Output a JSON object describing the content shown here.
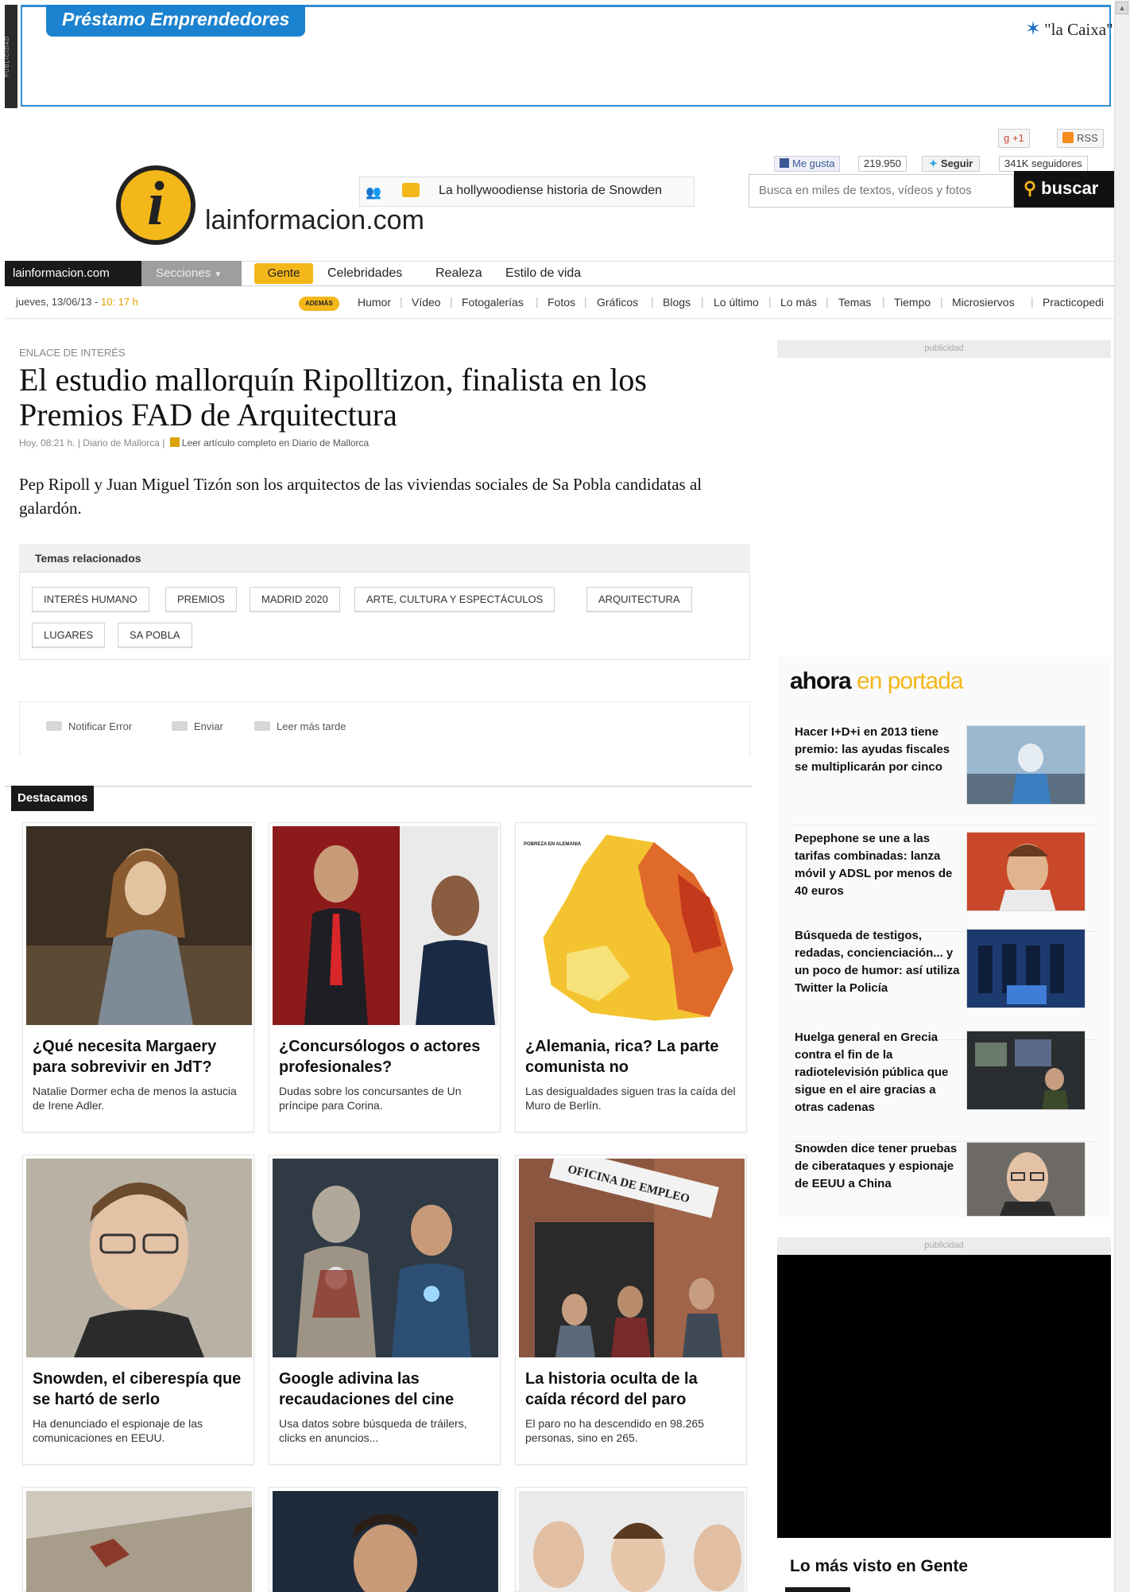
{
  "ad": {
    "side_label": "PUBLICIDAD",
    "title": "Préstamo Emprendedores",
    "brand": "\"la Caixa\""
  },
  "social": {
    "gplus": "+1",
    "rss": "RSS",
    "fb_like": "Me gusta",
    "fb_count": "219.950",
    "tw_follow": "Seguir",
    "tw_count": "341K seguidores"
  },
  "header": {
    "logo_text": "lainformacion",
    "logo_suffix": ".com",
    "notice": "La hollywoodiense historia de Snowden",
    "search_placeholder": "Busca en miles de textos, vídeos y fotos",
    "search_button": "buscar"
  },
  "nav": {
    "home": "lainformacion.com",
    "sections": "Secciones",
    "items": [
      "Gente",
      "Celebridades",
      "Realeza",
      "Estilo de vida"
    ]
  },
  "subnav": {
    "date": "jueves, 13/06/13 - ",
    "time": "10: 17 h",
    "ademas": "ADEMÁS",
    "links": [
      "Humor",
      "Vídeo",
      "Fotogalerías",
      "Fotos",
      "Gráficos",
      "Blogs",
      "Lo último",
      "Lo más",
      "Temas",
      "Tiempo",
      "Microsiervos",
      "Practicopedi"
    ]
  },
  "article": {
    "kicker": "ENLACE DE INTERÉS",
    "headline": "El estudio mallorquín Ripolltizon, finalista en los Premios FAD de Arquitectura",
    "byline": "Hoy, 08:21 h. | Diario de Mallorca |",
    "source_link": "Leer artículo completo en Diario de Mallorca",
    "lead": "Pep Ripoll y Juan Miguel Tizón son los arquitectos de las viviendas sociales de Sa Pobla candidatas al galardón.",
    "temas_title": "Temas relacionados",
    "tags": [
      "INTERÉS HUMANO",
      "PREMIOS",
      "MADRID 2020",
      "ARTE, CULTURA Y ESPECTÁCULOS",
      "ARQUITECTURA",
      "LUGARES",
      "SA POBLA"
    ],
    "actions": [
      "Notificar Error",
      "Enviar",
      "Leer más tarde"
    ]
  },
  "destacamos": {
    "label": "Destacamos",
    "cards": [
      {
        "title": "¿Qué necesita Margaery para sobrevivir en JdT?",
        "desc": "Natalie Dormer echa de menos la astucia de Irene Adler."
      },
      {
        "title": "¿Concursólogos o actores profesionales?",
        "desc": "Dudas sobre los concursantes de Un príncipe para Corina."
      },
      {
        "title": "¿Alemania, rica? La parte comunista no",
        "desc": "Las desigualdades siguen tras la caída del Muro de Berlín.",
        "map_label": "POBREZA EN ALEMANIA"
      },
      {
        "title": "Snowden, el ciberespía que se hartó de serlo",
        "desc": "Ha denunciado el espionaje de las comunicaciones en EEUU."
      },
      {
        "title": "Google adivina las recaudaciones del cine",
        "desc": "Usa datos sobre búsqueda de tráilers, clicks en anuncios..."
      },
      {
        "title": "La historia oculta de la caída récord del paro",
        "desc": "El paro no ha descendido en 98.265 personas, sino en 265.",
        "sign": "OFICINA DE EMPLEO"
      }
    ]
  },
  "sidebar": {
    "pub_label": "publicidad",
    "ahora_a": "ahora",
    "ahora_b": "en portada",
    "items": [
      "Hacer I+D+i en 2013 tiene premio: las ayudas fiscales se multiplicarán por cinco",
      "Pepephone se une a las tarifas combinadas: lanza móvil y ADSL por menos de 40 euros",
      "Búsqueda de testigos, redadas, concienciación... y un poco de humor: así utiliza Twitter la Policía",
      "Huelga general en Grecia contra el fin de la radiotelevisión pública que sigue en el aire gracias a otras cadenas",
      "Snowden dice tener pruebas de ciberataques y espionaje de EEUU a China"
    ],
    "mas_visto": "Lo más visto en Gente"
  }
}
